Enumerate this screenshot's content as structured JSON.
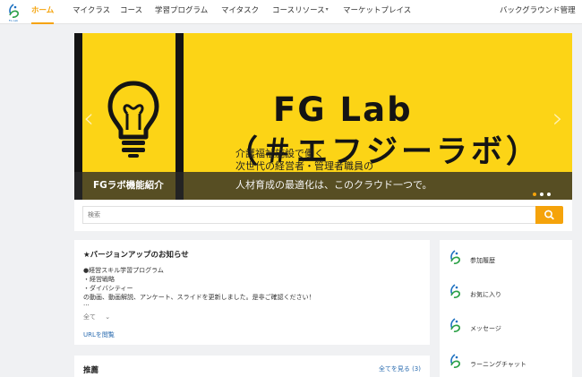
{
  "nav": {
    "logo_text": "FG Lab",
    "items": [
      {
        "label": "ホーム"
      },
      {
        "label": "マイクラス"
      },
      {
        "label": "コース"
      },
      {
        "label": "学習プログラム"
      },
      {
        "label": "マイタスク"
      },
      {
        "label": "コースリソース"
      },
      {
        "label": "マーケットプレイス"
      }
    ],
    "right_label": "バックグラウンド管理",
    "accent_color": "#f5a30b"
  },
  "banner": {
    "title_line1": "FG Lab",
    "title_line2": "（＃エフジーラボ）",
    "sub_line1": "介護福祉施設で働く",
    "sub_line2": "次世代の経営者・管理者職員の",
    "sub_line3": "人材育成の最適化は、このクラウド一つで。",
    "overlay_title": "FGラボ機能紹介",
    "slide_count": 3,
    "active_slide": 1,
    "background_color": "#fcd416"
  },
  "search": {
    "placeholder": "検索"
  },
  "news": {
    "title": "★バージョンアップのお知らせ",
    "lines": [
      "●経営スキル学習プログラム",
      "・経営戦略",
      "・ダイバシティー",
      "の動画、動画解説、アンケート、スライドを更新しました。是非ご確認ください！"
    ],
    "ellipsis": "...",
    "expand_label": "全て",
    "url_link": "URLを閲覧"
  },
  "recommend": {
    "title": "推薦",
    "see_all": "全てを見る (3)"
  },
  "side_menu": [
    {
      "label": "参加履歴",
      "icon": "fg-logo-icon"
    },
    {
      "label": "お気に入り",
      "icon": "fg-logo-icon"
    },
    {
      "label": "メッセージ",
      "icon": "fg-logo-icon"
    },
    {
      "label": "ラーニングチャット",
      "icon": "fg-logo-icon"
    }
  ]
}
